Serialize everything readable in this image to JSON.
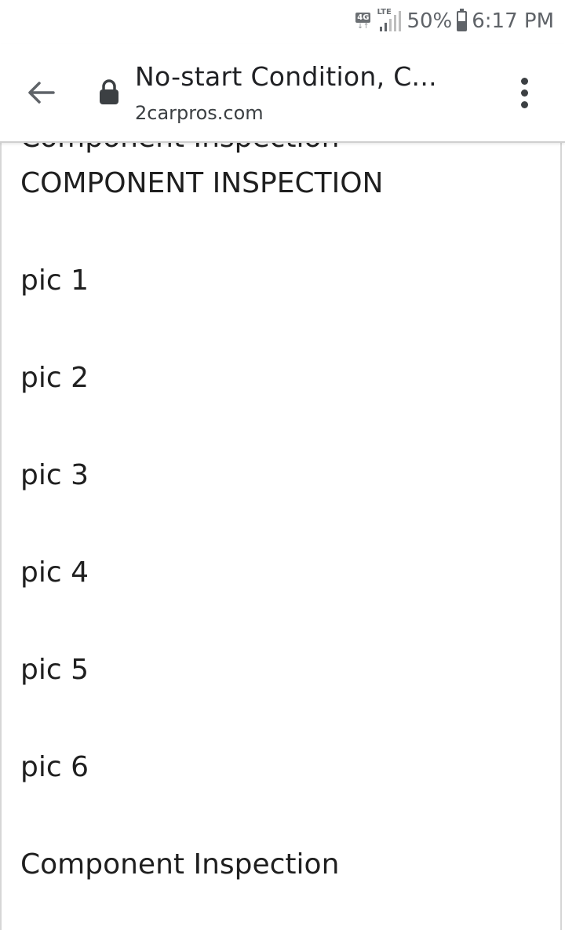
{
  "status_bar": {
    "network": "4G",
    "network_type": "LTE",
    "battery_percent": "50%",
    "battery_level": 0.5,
    "time": "6:17 PM"
  },
  "toolbar": {
    "page_title": "No-start Condition, C...",
    "domain": "2carpros.com",
    "icons": [
      "back-arrow-icon",
      "lock-icon",
      "more-vert-icon"
    ]
  },
  "content": {
    "partial_heading": "Component Inspection",
    "heading_caps": "COMPONENT INSPECTION",
    "pics": [
      "pic 1",
      "pic 2",
      "pic 3",
      "pic 4",
      "pic 5",
      "pic 6"
    ],
    "footer_heading": "Component Inspection"
  }
}
